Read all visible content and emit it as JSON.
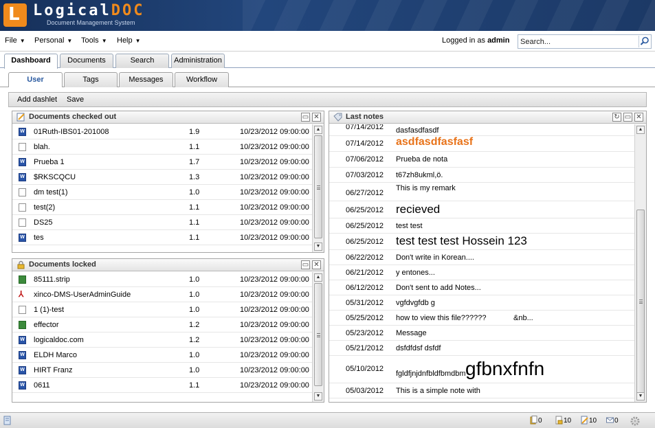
{
  "app": {
    "logo_letter": "L",
    "logo_name_part1": "Logical",
    "logo_name_part2": "DOC",
    "logo_subtitle": "Document Management System"
  },
  "menu": {
    "items": [
      {
        "label": "File"
      },
      {
        "label": "Personal"
      },
      {
        "label": "Tools"
      },
      {
        "label": "Help"
      }
    ],
    "logged_prefix": "Logged in as",
    "logged_user": "admin",
    "search_placeholder": "Search..."
  },
  "main_tabs": [
    {
      "label": "Dashboard",
      "active": true
    },
    {
      "label": "Documents"
    },
    {
      "label": "Search"
    },
    {
      "label": "Administration"
    }
  ],
  "sub_tabs": [
    {
      "label": "User",
      "active": true
    },
    {
      "label": "Tags"
    },
    {
      "label": "Messages"
    },
    {
      "label": "Workflow"
    }
  ],
  "toolbar": {
    "add_dashlet": "Add dashlet",
    "save": "Save"
  },
  "checked_out": {
    "title": "Documents checked out",
    "rows": [
      {
        "name": "01Ruth-IBS01-201008",
        "version": "1.9",
        "date": "10/23/2012 09:00:00",
        "icon": "word-icon"
      },
      {
        "name": "blah.",
        "version": "1.1",
        "date": "10/23/2012 09:00:00",
        "icon": "text-file-icon"
      },
      {
        "name": "Prueba 1",
        "version": "1.7",
        "date": "10/23/2012 09:00:00",
        "icon": "word-icon"
      },
      {
        "name": "$RKSCQCU",
        "version": "1.3",
        "date": "10/23/2012 09:00:00",
        "icon": "word-icon"
      },
      {
        "name": "dm test(1)",
        "version": "1.0",
        "date": "10/23/2012 09:00:00",
        "icon": "text-file-icon"
      },
      {
        "name": "test(2)",
        "version": "1.1",
        "date": "10/23/2012 09:00:00",
        "icon": "text-file-icon"
      },
      {
        "name": "DS25",
        "version": "1.1",
        "date": "10/23/2012 09:00:00",
        "icon": "text-file-icon"
      },
      {
        "name": "tes",
        "version": "1.1",
        "date": "10/23/2012 09:00:00",
        "icon": "word-icon"
      }
    ]
  },
  "locked": {
    "title": "Documents locked",
    "rows": [
      {
        "name": "85111.strip",
        "version": "1.0",
        "date": "10/23/2012 09:00:00",
        "icon": "spreadsheet-icon"
      },
      {
        "name": "xinco-DMS-UserAdminGuide",
        "version": "1.0",
        "date": "10/23/2012 09:00:00",
        "icon": "pdf-icon"
      },
      {
        "name": "1 (1)-test",
        "version": "1.0",
        "date": "10/23/2012 09:00:00",
        "icon": "text-file-icon"
      },
      {
        "name": "effector",
        "version": "1.2",
        "date": "10/23/2012 09:00:00",
        "icon": "spreadsheet-icon"
      },
      {
        "name": "logicaldoc.com",
        "version": "1.2",
        "date": "10/23/2012 09:00:00",
        "icon": "word-icon"
      },
      {
        "name": "ELDH Marco",
        "version": "1.0",
        "date": "10/23/2012 09:00:00",
        "icon": "word-icon"
      },
      {
        "name": "HIRT Franz",
        "version": "1.0",
        "date": "10/23/2012 09:00:00",
        "icon": "word-icon"
      },
      {
        "name": "0611",
        "version": "1.1",
        "date": "10/23/2012 09:00:00",
        "icon": "word-icon"
      }
    ]
  },
  "notes": {
    "title": "Last notes",
    "rows": [
      {
        "date": "07/14/2012",
        "text": "dasfasdfasdf",
        "style": "normal"
      },
      {
        "date": "07/14/2012",
        "text": "asdfasdfasfasf",
        "style": "orange"
      },
      {
        "date": "07/06/2012",
        "text": "Prueba de nota",
        "style": "normal"
      },
      {
        "date": "07/03/2012",
        "text": "t67zh8ukml,ö.",
        "style": "normal"
      },
      {
        "date": "06/27/2012",
        "text": "This is my remark",
        "style": "top"
      },
      {
        "date": "06/25/2012",
        "text": "recieved",
        "style": "big"
      },
      {
        "date": "06/25/2012",
        "text": "test test",
        "style": "normal"
      },
      {
        "date": "06/25/2012",
        "text": "test test test Hossein 123",
        "style": "big"
      },
      {
        "date": "06/22/2012",
        "text": "Don't write in Korean....",
        "style": "normal"
      },
      {
        "date": "06/21/2012",
        "text": "y entones...",
        "style": "normal"
      },
      {
        "date": "06/12/2012",
        "text": "Don't sent to add Notes...",
        "style": "normal"
      },
      {
        "date": "05/31/2012",
        "text": "vgfdvgfdb g",
        "style": "normal"
      },
      {
        "date": "05/25/2012",
        "text": "how to view this file??????",
        "extra": "&nb...",
        "style": "normal"
      },
      {
        "date": "05/23/2012",
        "text": "Message",
        "style": "normal"
      },
      {
        "date": "05/21/2012",
        "text": "dsfdfdsf dsfdf",
        "style": "normal"
      },
      {
        "date": "05/10/2012",
        "text": "fgldfjnjdnfbldfbmdbm",
        "extra": "gfbnxfnfn",
        "style": "huge"
      },
      {
        "date": "05/03/2012",
        "text": "This is a simple note with",
        "style": "normal"
      }
    ]
  },
  "status": {
    "checked_out_count": "0",
    "locked_count": "10",
    "edit_count": "10",
    "messages_count": "0"
  },
  "colors": {
    "header_bg": "#1c3966",
    "accent_orange": "#f08a1c",
    "note_orange": "#e8731a",
    "tab_text_active": "#2a5aa0"
  }
}
